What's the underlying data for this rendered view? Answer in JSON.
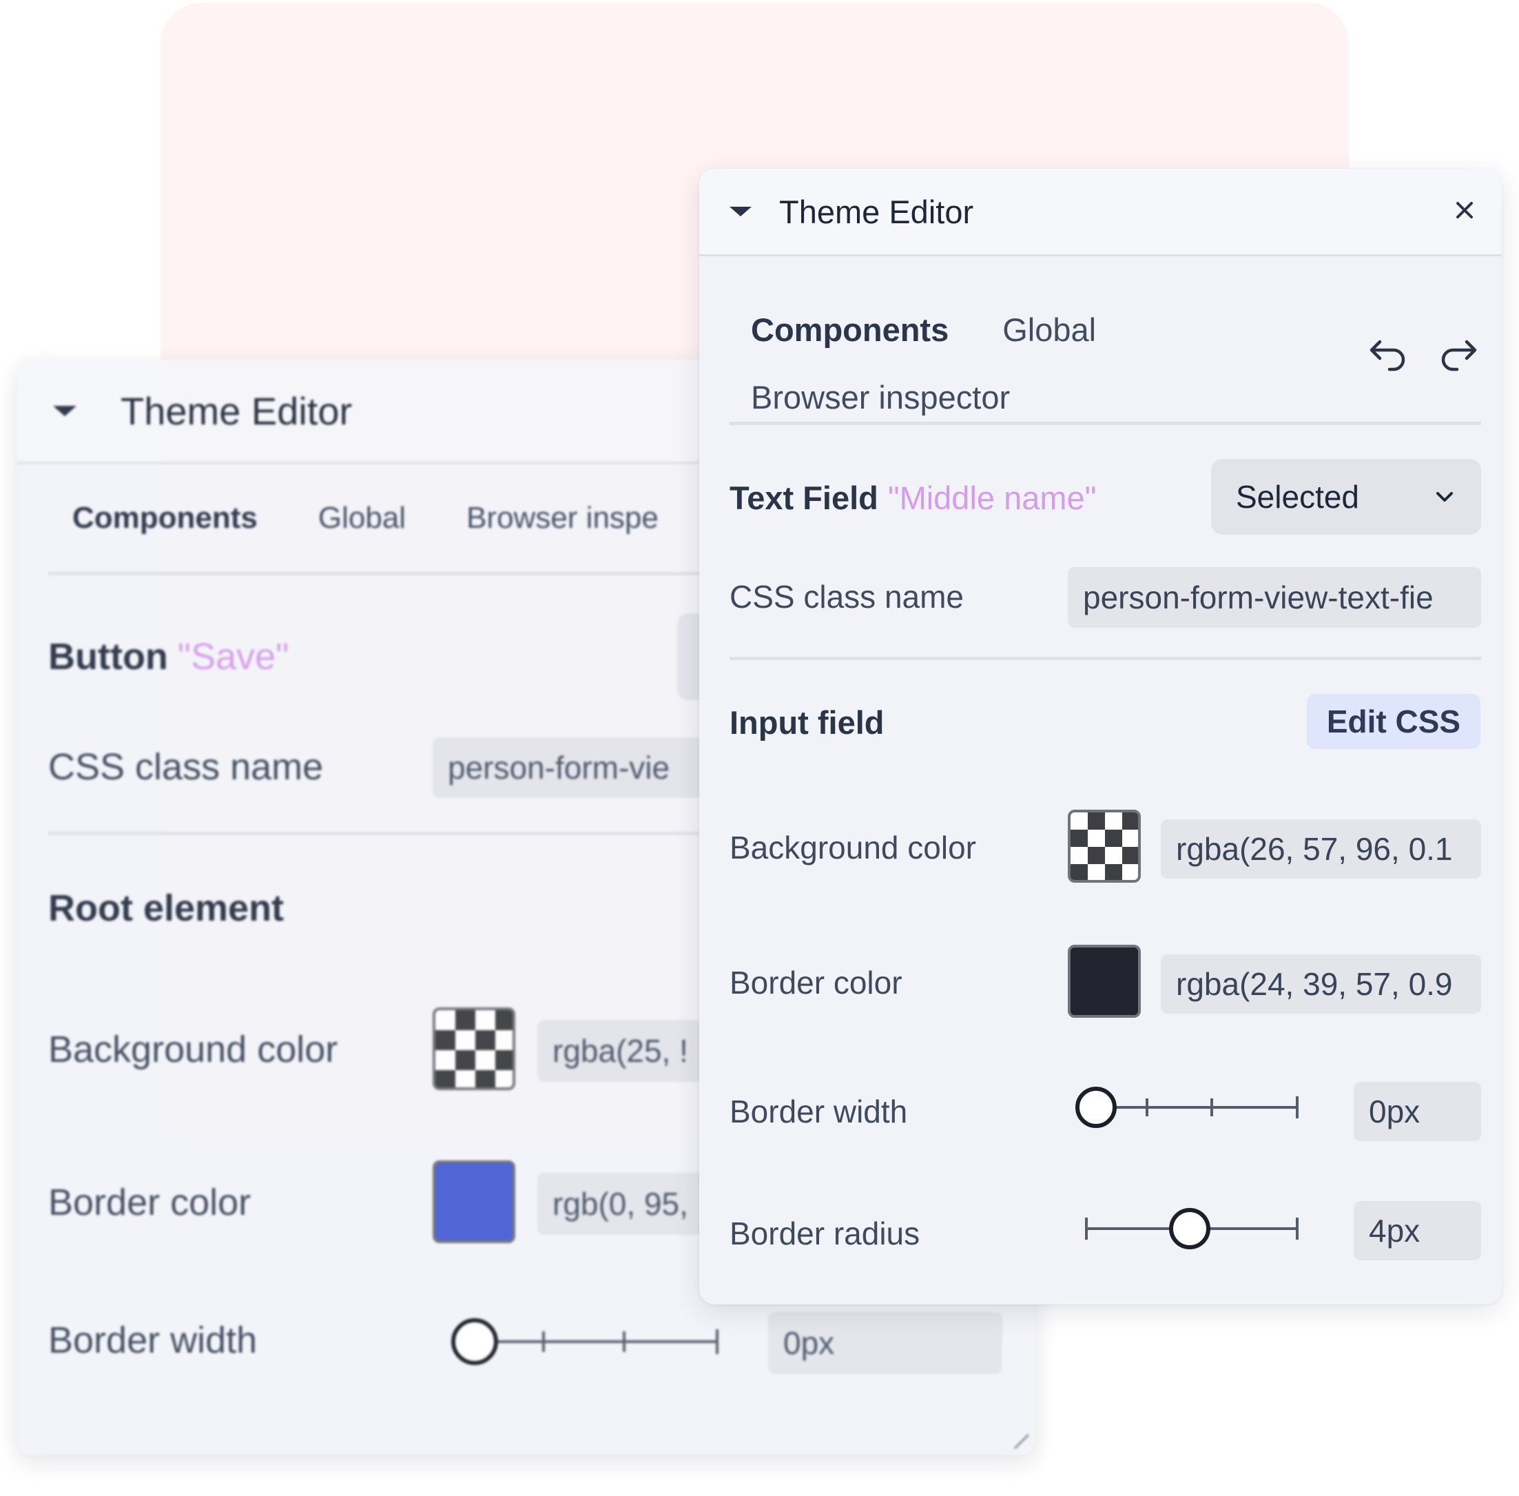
{
  "back_panel": {
    "title": "Theme Editor",
    "tabs": [
      "Components",
      "Global",
      "Browser inspe"
    ],
    "component_type": "Button",
    "component_name": "\"Save\"",
    "css_class_label": "CSS class name",
    "css_class_value": "person-form-vie",
    "section_title": "Root element",
    "rows": {
      "background_color": {
        "label": "Background color",
        "value": "rgba(25, !"
      },
      "border_color": {
        "label": "Border color",
        "value": "rgb(0, 95,",
        "swatch": "#4a5fd3"
      },
      "border_width": {
        "label": "Border width",
        "value": "0px",
        "level": 0
      }
    }
  },
  "front_panel": {
    "title": "Theme Editor",
    "tabs": [
      "Components",
      "Global",
      "Browser inspector"
    ],
    "active_tab": "Components",
    "component_type": "Text Field",
    "component_name": "\"Middle name\"",
    "state_dropdown": "Selected",
    "css_class_label": "CSS class name",
    "css_class_value": "person-form-view-text-fie",
    "section_title": "Input field",
    "edit_css_label": "Edit CSS",
    "rows": {
      "background_color": {
        "label": "Background color",
        "value": "rgba(26, 57, 96, 0.1"
      },
      "border_color": {
        "label": "Border color",
        "value": "rgba(24, 39, 57, 0.9",
        "swatch": "#22252f"
      },
      "border_width": {
        "label": "Border width",
        "value": "0px",
        "level": 0
      },
      "border_radius": {
        "label": "Border radius",
        "value": "4px",
        "level": 0.5
      }
    },
    "icons": {
      "collapse": "caret-down-icon",
      "close": "close-icon",
      "undo": "undo-icon",
      "redo": "redo-icon",
      "dropdown": "chevron-down-icon"
    }
  },
  "colors": {
    "backdrop": "#fff3f3",
    "accent_quoted_name": "#d59de9",
    "edit_css_bg": "#dfe6fb"
  }
}
